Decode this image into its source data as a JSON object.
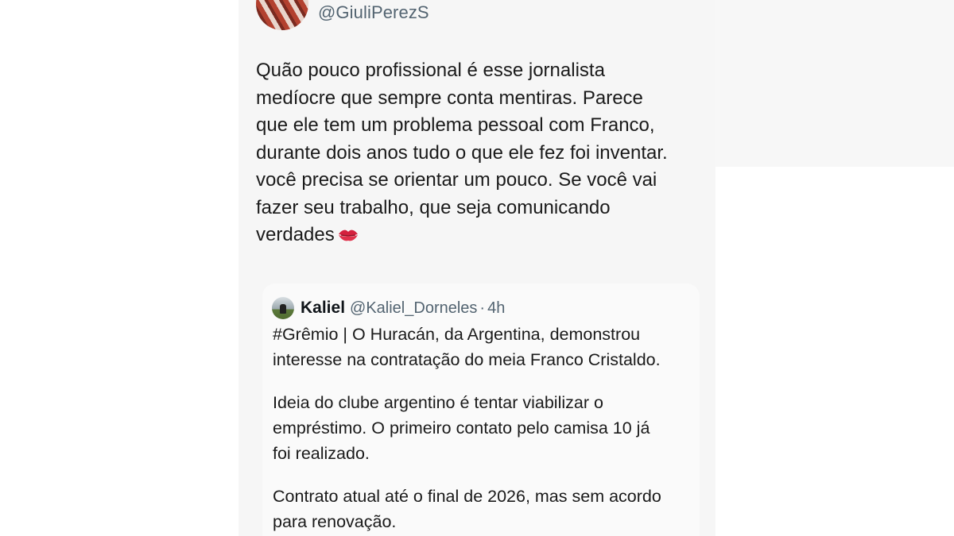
{
  "tweet": {
    "handle": "@GiuliPerezS",
    "lines": [
      "Quão pouco profissional é esse jornalista",
      "medíocre que sempre conta mentiras. Parece",
      "que ele tem um problema pessoal com Franco,",
      "durante dois anos tudo o que ele fez foi inventar.",
      "você precisa se orientar um pouco. Se você vai",
      "fazer seu trabalho, que seja comunicando",
      "verdades"
    ],
    "emoji_icon": "kiss-mark-icon"
  },
  "quote": {
    "name": "Kaliel",
    "handle": "@Kaliel_Dorneles",
    "separator": "·",
    "time": "4h",
    "lines": [
      "#Grêmio | O Huracán, da Argentina, demonstrou",
      "interesse na contratação do meia Franco Cristaldo.",
      "",
      "Ideia do clube argentino é tentar viabilizar o",
      "empréstimo. O primeiro contato pelo camisa 10 já",
      "foi realizado.",
      "",
      "Contrato atual até o final de 2026, mas sem acordo",
      "para renovação."
    ]
  },
  "colors": {
    "text": "#1a1a1a",
    "muted": "#536471",
    "card_bg": "#f6f6f6",
    "quote_bg": "#fafafa",
    "emoji": "#d4213d"
  }
}
